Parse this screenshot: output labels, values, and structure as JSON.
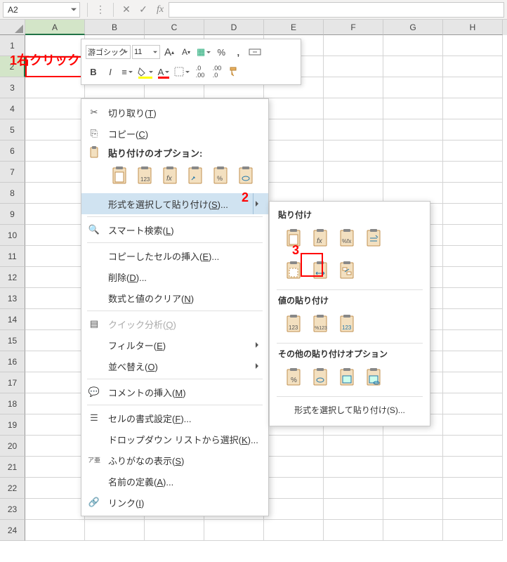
{
  "namebox": "A2",
  "columns": [
    "A",
    "B",
    "C",
    "D",
    "E",
    "F",
    "G",
    "H"
  ],
  "rows": [
    "1",
    "2",
    "3",
    "4",
    "5",
    "6",
    "7",
    "8",
    "9",
    "10",
    "11",
    "12",
    "13",
    "14",
    "15",
    "16",
    "17",
    "18",
    "19",
    "20",
    "21",
    "22",
    "23",
    "24"
  ],
  "annotations": {
    "a1": "1右クリック",
    "a2": "2",
    "a3": "3"
  },
  "mini": {
    "font": "游ゴシック",
    "size": "11",
    "bold": "B",
    "italic": "I",
    "incFont": "A",
    "decFont": "A",
    "percent": "%",
    "comma": ",",
    "decInc": ".00",
    "decDec": ".00",
    "furigana": "ア亜"
  },
  "ctx": {
    "cut": "切り取り",
    "cut_u": "T",
    "copy": "コピー",
    "copy_u": "C",
    "pasteOptsHead": "貼り付けのオプション:",
    "pasteSpecial": "形式を選択して貼り付け",
    "pasteSpecial_u": "S",
    "smart": "スマート検索",
    "smart_u": "L",
    "insertCopied": "コピーしたセルの挿入",
    "insertCopied_u": "E",
    "delete": "削除",
    "delete_u": "D",
    "clear": "数式と値のクリア",
    "clear_u": "N",
    "quick": "クイック分析",
    "quick_u": "Q",
    "filter": "フィルター",
    "filter_u": "E",
    "sort": "並べ替え",
    "sort_u": "O",
    "comment": "コメントの挿入",
    "comment_u": "M",
    "format": "セルの書式設定",
    "format_u": "F",
    "dropdown": "ドロップダウン リストから選択",
    "dropdown_u": "K",
    "furigana": "ふりがなの表示",
    "furigana_u": "S",
    "defineName": "名前の定義",
    "defineName_u": "A",
    "link": "リンク",
    "link_u": "I"
  },
  "fly": {
    "sec1": "貼り付け",
    "sec2": "値の貼り付け",
    "sec3": "その他の貼り付けオプション",
    "dialog": "形式を選択して貼り付け(S)..."
  },
  "clipboard_color": "#d9964e"
}
